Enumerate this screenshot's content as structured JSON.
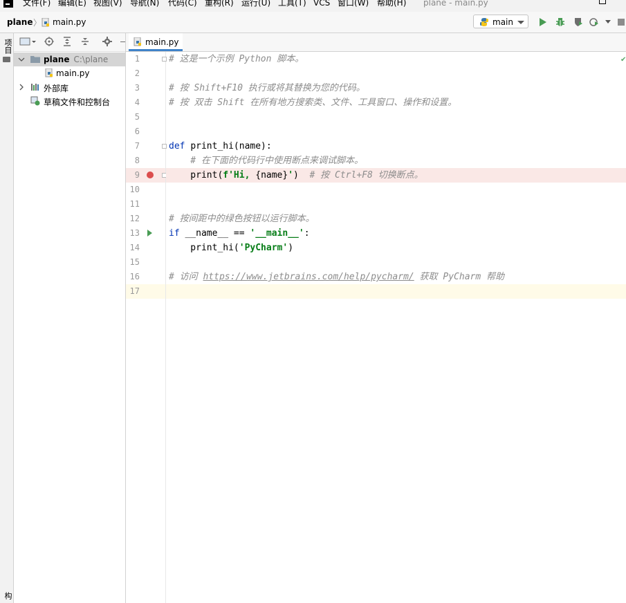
{
  "menubar": {
    "items": [
      "文件(F)",
      "编辑(E)",
      "视图(V)",
      "导航(N)",
      "代码(C)",
      "重构(R)",
      "运行(U)",
      "工具(T)",
      "VCS",
      "窗口(W)",
      "帮助(H)"
    ],
    "window_title": "plane - main.py"
  },
  "navbar": {
    "project": "plane",
    "file": "main.py",
    "run_config": "main"
  },
  "side_strip": {
    "project_label": "项目",
    "bottom_label": "结构"
  },
  "project_tree": {
    "root_name": "plane",
    "root_path": "C:\\plane",
    "file": "main.py",
    "external_libs": "外部库",
    "scratches": "草稿文件和控制台"
  },
  "editor": {
    "tab": "main.py",
    "lines": [
      {
        "n": "1",
        "parts": [
          {
            "c": "cm",
            "t": "# 这是一个示例 Python 脚本。"
          }
        ]
      },
      {
        "n": "2",
        "parts": []
      },
      {
        "n": "3",
        "parts": [
          {
            "c": "cm",
            "t": "# 按 Shift+F10 执行或将其替换为您的代码。"
          }
        ]
      },
      {
        "n": "4",
        "parts": [
          {
            "c": "cm",
            "t": "# 按 双击 Shift 在所有地方搜索类、文件、工具窗口、操作和设置。"
          }
        ]
      },
      {
        "n": "5",
        "parts": []
      },
      {
        "n": "6",
        "parts": []
      },
      {
        "n": "7",
        "parts": [
          {
            "c": "kw",
            "t": "def "
          },
          {
            "c": "fn",
            "t": "print_hi(name):"
          }
        ]
      },
      {
        "n": "8",
        "parts": [
          {
            "c": "cm",
            "t": "    # 在下面的代码行中使用断点来调试脚本。"
          }
        ]
      },
      {
        "n": "9",
        "parts": [
          {
            "c": "fn",
            "t": "    print("
          },
          {
            "c": "str",
            "t": "f'Hi, "
          },
          {
            "c": "fn",
            "t": "{name}"
          },
          {
            "c": "str",
            "t": "'"
          },
          {
            "c": "fn",
            "t": ")  "
          },
          {
            "c": "cm",
            "t": "# 按 Ctrl+F8 切换断点。"
          }
        ]
      },
      {
        "n": "10",
        "parts": []
      },
      {
        "n": "11",
        "parts": []
      },
      {
        "n": "12",
        "parts": [
          {
            "c": "cm",
            "t": "# 按间距中的绿色按钮以运行脚本。"
          }
        ]
      },
      {
        "n": "13",
        "parts": [
          {
            "c": "kw",
            "t": "if "
          },
          {
            "c": "fn",
            "t": "__name__ == "
          },
          {
            "c": "str",
            "t": "'__main__'"
          },
          {
            "c": "fn",
            "t": ":"
          }
        ]
      },
      {
        "n": "14",
        "parts": [
          {
            "c": "fn",
            "t": "    print_hi("
          },
          {
            "c": "str",
            "t": "'PyCharm'"
          },
          {
            "c": "fn",
            "t": ")"
          }
        ]
      },
      {
        "n": "15",
        "parts": []
      },
      {
        "n": "16",
        "parts": [
          {
            "c": "cm",
            "t": "# 访问 "
          },
          {
            "c": "link",
            "t": "https://www.jetbrains.com/help/pycharm/"
          },
          {
            "c": "cm",
            "t": " 获取 PyCharm 帮助"
          }
        ]
      },
      {
        "n": "17",
        "parts": []
      }
    ],
    "breakpoint_line": "9",
    "run_line": "13",
    "current_line": "17"
  },
  "colors": {
    "breakpoint": "#db4d4d",
    "run": "#499c54",
    "keyword": "#0033b3",
    "string": "#067d17",
    "comment": "#8c8c8c",
    "tab_accent": "#4083c9"
  }
}
